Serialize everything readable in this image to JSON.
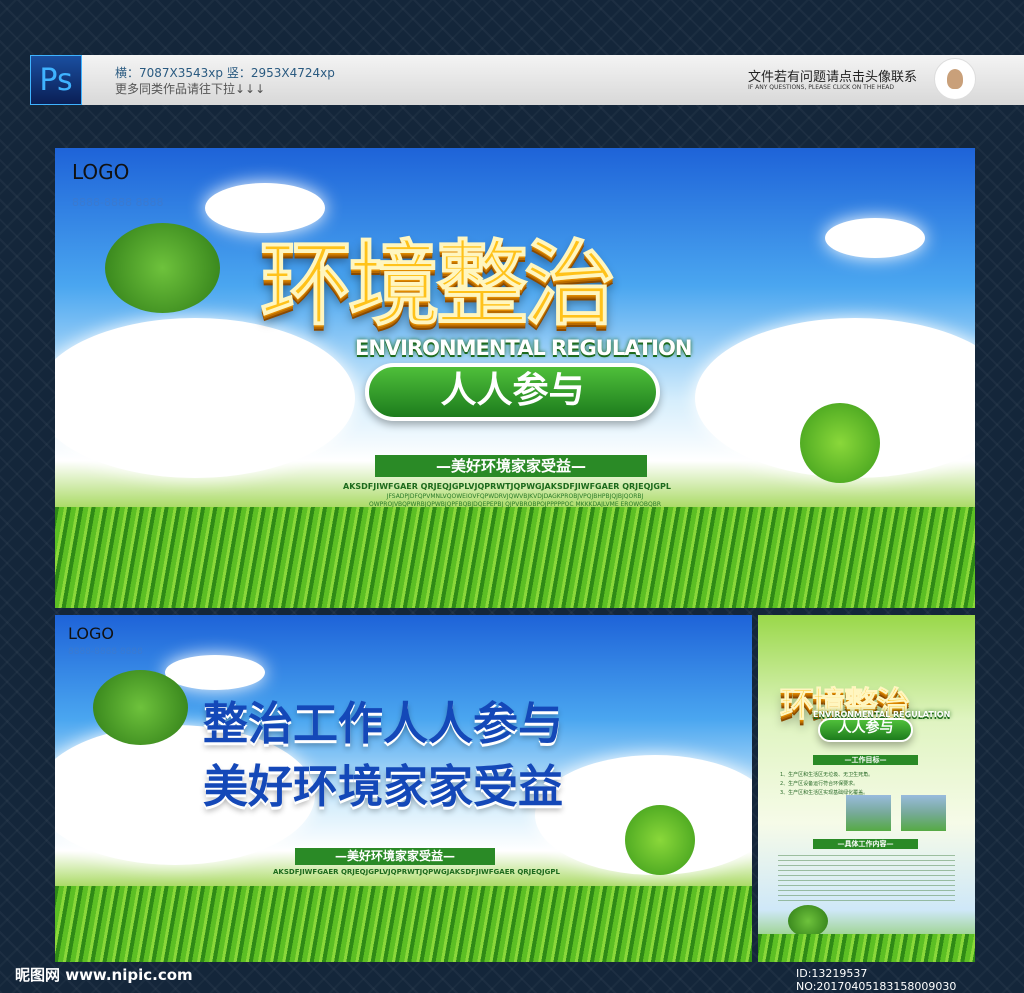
{
  "header": {
    "ps_label": "Ps",
    "size_line": "横：7087X3543xp   竖：2953X4724xp",
    "more_line": "更多同类作品请往下拉↓↓↓",
    "contact_cn": "文件若有问题请点击头像联系",
    "contact_en": "IF ANY QUESTIONS, PLEASE CLICK ON THE HEAD"
  },
  "main_banner": {
    "logo": "LOGO",
    "phone": "8888-8888 8888",
    "title": "环境整治",
    "subtitle_en": "ENVIRONMENTAL REGULATION",
    "slogan_pill": "人人参与",
    "ribbon": "—美好环境家家受益—",
    "filler_line": "AKSDFJIWFGAER QRJEQJGPLVJQPRWTJQPWGJAKSDFJIWFGAER QRJEQJGPL",
    "filler_small": "JFSADPJDFQPVMNLVQOWEIOVFQPWDRVJQWVBJKVDJDAGKPROBJVPQJBHPBJQJBJQORBJ OWPROJVBQPWRBJQPWBJQPFBQBJDQEPEPBJ QJPVBROBPOJPPPPPOC MKKKDAJLVME EROWOBQBR"
  },
  "second_banner": {
    "logo": "LOGO",
    "phone": "8888-8888 8888",
    "line1": "整治工作人人参与",
    "line2": "美好环境家家受益",
    "ribbon": "—美好环境家家受益—",
    "filler_line": "AKSDFJIWFGAER QRJEQJGPLVJQPRWTJQPWGJAKSDFJIWFGAER QRJEQJGPL"
  },
  "poster": {
    "title": "环境整治",
    "subtitle_en": "ENVIRONMENTAL REGULATION",
    "pill": "人人参与",
    "section1": "—工作目标—",
    "goals": [
      "1、生产区和生活区无垃圾、无卫生死角。",
      "2、生产区设备运行符合环保要求。",
      "3、生产区和生活区实现基础绿化覆盖。"
    ],
    "section2": "—具体工作内容—"
  },
  "footer": {
    "site": "昵图网 www.nipic.com",
    "id": "ID:13219537 NO:20170405183158009030"
  }
}
